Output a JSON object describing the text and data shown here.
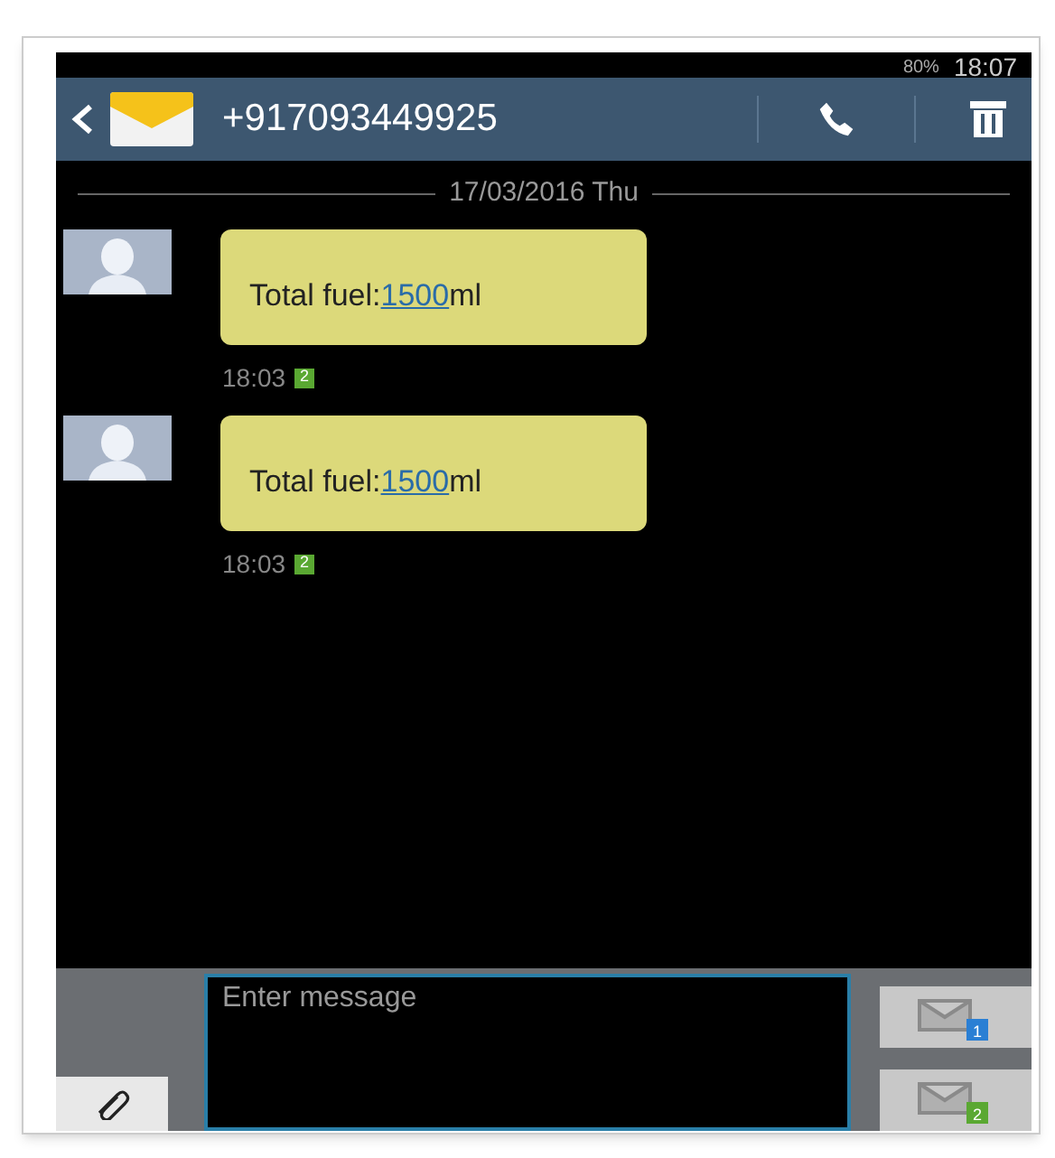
{
  "status_bar": {
    "battery": "80%",
    "time": "18:07"
  },
  "header": {
    "contact": "+917093449925"
  },
  "date_divider": "17/03/2016 Thu",
  "messages": [
    {
      "before": "Total fuel:",
      "link": "1500",
      "after": "ml",
      "time": "18:03",
      "sim": "2"
    },
    {
      "before": "Total fuel:",
      "link": "1500",
      "after": "ml",
      "time": "18:03",
      "sim": "2"
    }
  ],
  "composer": {
    "placeholder": "Enter message",
    "send_buttons": [
      {
        "sim": "1",
        "color": "#2a7fd4"
      },
      {
        "sim": "2",
        "color": "#5aa832"
      }
    ]
  }
}
